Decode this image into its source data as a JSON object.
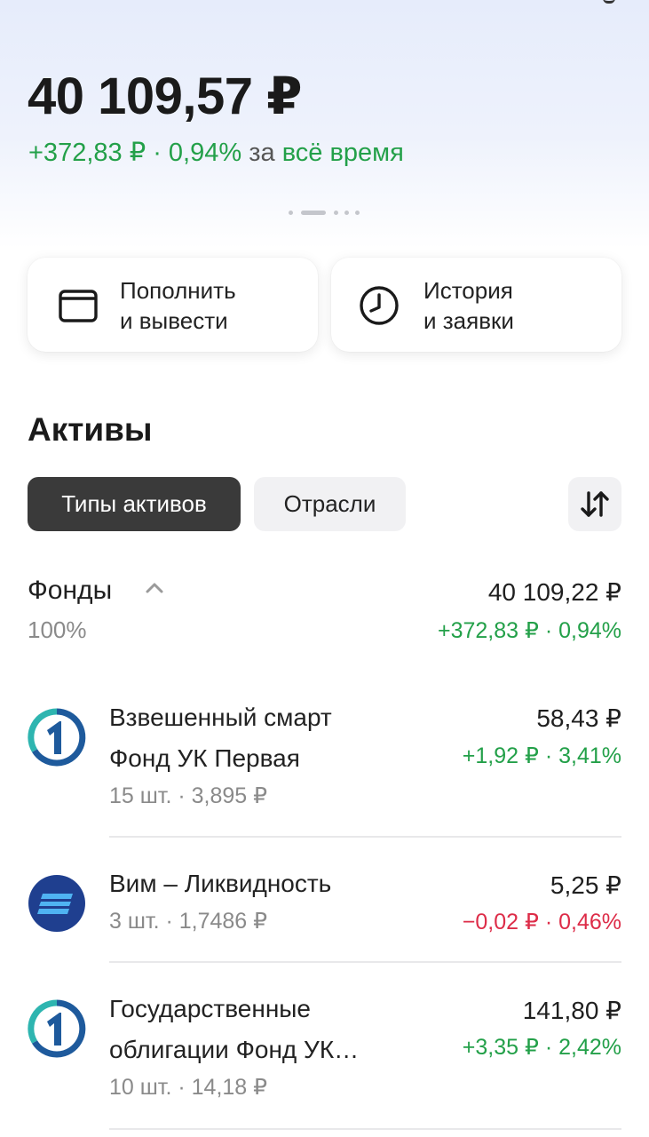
{
  "portfolio": {
    "balance": "40 109,57 ₽",
    "change_amount": "+372,83 ₽ · 0,94%",
    "change_period_prefix": "за",
    "change_period": "всё время"
  },
  "actions": {
    "deposit_label_line1": "Пополнить",
    "deposit_label_line2": "и вывести",
    "deposit_icon": "wallet-icon",
    "history_label_line1": "История",
    "history_label_line2": "и заявки",
    "history_icon": "clock-icon"
  },
  "assets": {
    "title": "Активы",
    "tabs": [
      "Типы активов",
      "Отрасли"
    ],
    "active_tab": "Типы активов",
    "sort_icon": "sort-arrows-icon"
  },
  "group": {
    "name": "Фонды",
    "share": "100%",
    "value": "40 109,22 ₽",
    "change": "+372,83 ₽ · 0,94%"
  },
  "items": [
    {
      "name_line1": "Взвешенный смарт",
      "name_line2": "Фонд УК Первая",
      "sub": "15 шт. · 3,895 ₽",
      "value": "58,43 ₽",
      "change": "+1,92 ₽ · 3,41%",
      "trend": "up",
      "logo": "pervaya-logo-icon"
    },
    {
      "name_line1": "Вим – Ликвидность",
      "sub": "3 шт. · 1,7486 ₽",
      "value": "5,25 ₽",
      "change": "−0,02 ₽ · 0,46%",
      "trend": "down",
      "logo": "vim-logo-icon"
    },
    {
      "name_line1": "Государственные",
      "name_line2": "облигации Фонд УК…",
      "sub": "10 шт. · 14,18 ₽",
      "value": "141,80 ₽",
      "change": "+3,35 ₽ · 2,42%",
      "trend": "up",
      "logo": "pervaya-logo-icon"
    }
  ],
  "colors": {
    "positive": "#23a049",
    "negative": "#dd2c48",
    "muted": "#8a8a8a",
    "chip_active": "#3a3a3a",
    "chip_inactive": "#f1f1f3",
    "vim_brand": "#1f3f8f",
    "pervaya_brand": "#1e5a9c",
    "pervaya_accent": "#2eb5b0"
  }
}
